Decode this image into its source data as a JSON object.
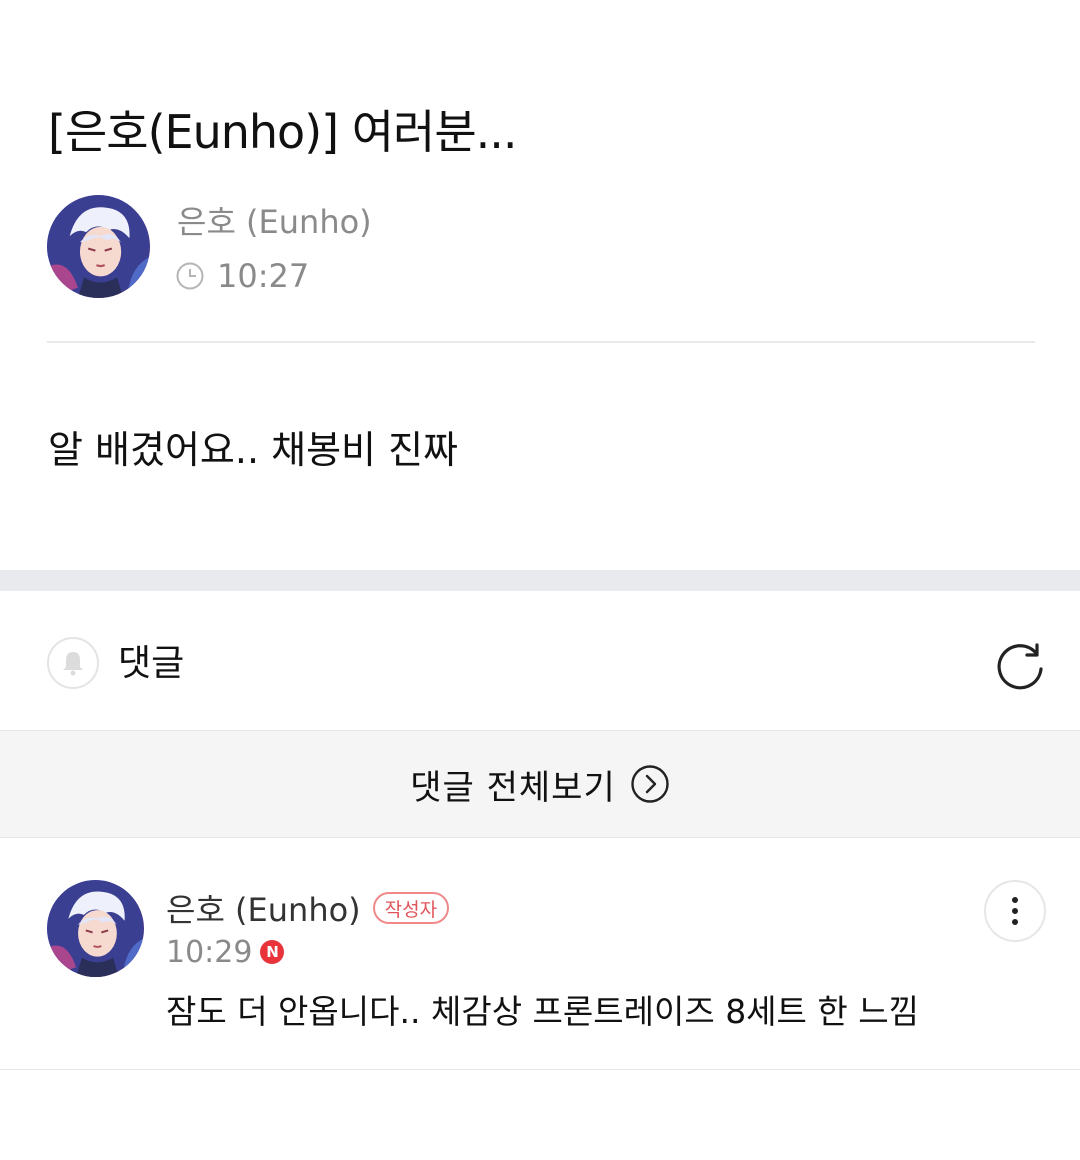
{
  "post": {
    "title": "[은호(Eunho)] 여러분...",
    "author": "은호 (Eunho)",
    "time": "10:27",
    "body": "알 배겼어요.. 채봉비 진짜"
  },
  "comments": {
    "title": "댓글",
    "view_all_label": "댓글 전체보기",
    "items": [
      {
        "author": "은호 (Eunho)",
        "badge": "작성자",
        "time": "10:29",
        "new_badge": "N",
        "text": "잠도 더 안옵니다.. 체감상 프론트레이즈 8세트 한 느낌"
      }
    ]
  },
  "icons": {
    "clock": "clock-icon",
    "bell": "bell-icon",
    "refresh": "refresh-icon",
    "view_all_arrow": "chevron-right-circle-icon",
    "more": "more-vertical-icon"
  },
  "colors": {
    "badge_red": "#e8333b",
    "writer_badge": "#e0555b",
    "muted_text": "#8a8a8a",
    "section_band": "#e9eaed"
  }
}
